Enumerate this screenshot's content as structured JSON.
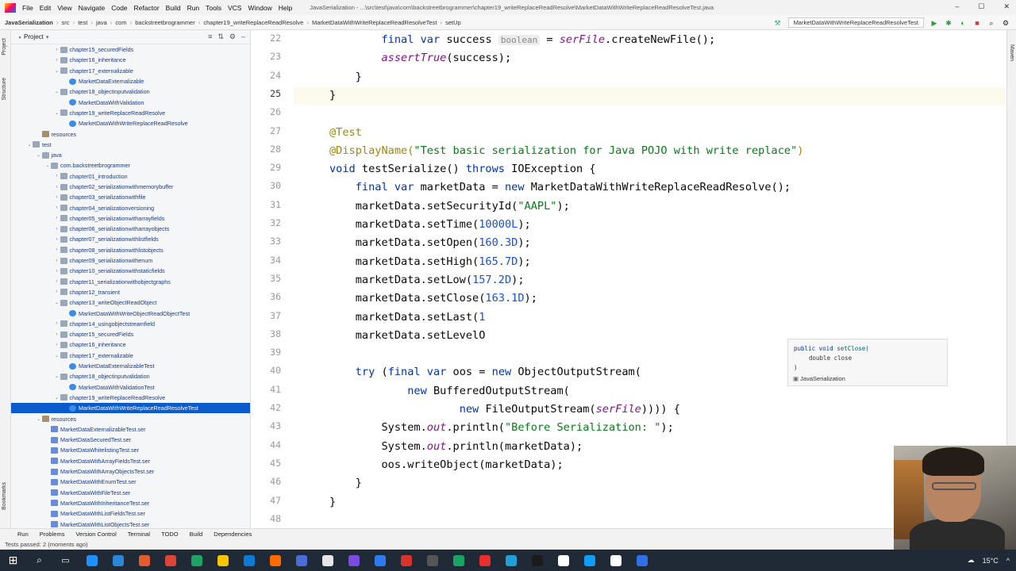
{
  "menubar": {
    "menus": [
      "File",
      "Edit",
      "View",
      "Navigate",
      "Code",
      "Refactor",
      "Build",
      "Run",
      "Tools",
      "VCS",
      "Window",
      "Help"
    ],
    "window_title": "JavaSerialization - ...\\src\\test\\java\\com\\backstreetbrogrammer\\chapter19_writeReplaceReadResolve\\MarketDataWithWriteReplaceReadResolveTest.java"
  },
  "navbar": {
    "crumbs": [
      "JavaSerialization",
      "src",
      "test",
      "java",
      "com",
      "backstreetbrogrammer",
      "chapter19_writeReplaceReadResolve",
      "MarketDataWithWriteReplaceReadResolveTest",
      "setUp"
    ],
    "run_config": "MarketDataWithWriteReplaceReadResolveTest"
  },
  "left_strip": {
    "project": "Project",
    "structure": "Structure",
    "bookmarks": "Bookmarks"
  },
  "right_strip": {
    "maven": "Maven"
  },
  "project_panel": {
    "title": "Project",
    "tree": [
      {
        "label": "chapter15_securedFields",
        "type": "folder",
        "indent": 5,
        "arrow": "›"
      },
      {
        "label": "chapter16_inheritance",
        "type": "folder",
        "indent": 5,
        "arrow": "›"
      },
      {
        "label": "chapter17_externalizable",
        "type": "folder",
        "indent": 5,
        "arrow": "⌄"
      },
      {
        "label": "MarketDataExternalizable",
        "type": "cls",
        "indent": 6,
        "arrow": ""
      },
      {
        "label": "chapter18_objectinputvalidation",
        "type": "folder",
        "indent": 5,
        "arrow": "⌄"
      },
      {
        "label": "MarketDataWithValidation",
        "type": "cls",
        "indent": 6,
        "arrow": ""
      },
      {
        "label": "chapter19_writeReplaceReadResolve",
        "type": "folder",
        "indent": 5,
        "arrow": "⌄"
      },
      {
        "label": "MarketDataWithWriteReplaceReadResolve",
        "type": "cls",
        "indent": 6,
        "arrow": ""
      },
      {
        "label": "resources",
        "type": "res",
        "indent": 3,
        "arrow": ""
      },
      {
        "label": "test",
        "type": "folder",
        "indent": 2,
        "arrow": "⌄"
      },
      {
        "label": "java",
        "type": "folder",
        "indent": 3,
        "arrow": "⌄"
      },
      {
        "label": "com.backstreetbrogrammer",
        "type": "folder",
        "indent": 4,
        "arrow": "⌄"
      },
      {
        "label": "chapter01_introduction",
        "type": "folder",
        "indent": 5,
        "arrow": "›"
      },
      {
        "label": "chapter02_serializationwithmemorybuffer",
        "type": "folder",
        "indent": 5,
        "arrow": "›"
      },
      {
        "label": "chapter03_serializationwithfile",
        "type": "folder",
        "indent": 5,
        "arrow": "›"
      },
      {
        "label": "chapter04_serializationversioning",
        "type": "folder",
        "indent": 5,
        "arrow": "›"
      },
      {
        "label": "chapter05_serializationwitharrayfields",
        "type": "folder",
        "indent": 5,
        "arrow": "›"
      },
      {
        "label": "chapter06_serializationwitharrayobjects",
        "type": "folder",
        "indent": 5,
        "arrow": "›"
      },
      {
        "label": "chapter07_serializationwithlistfields",
        "type": "folder",
        "indent": 5,
        "arrow": "›"
      },
      {
        "label": "chapter08_serializationwithlistobjects",
        "type": "folder",
        "indent": 5,
        "arrow": "›"
      },
      {
        "label": "chapter09_serializationwithenum",
        "type": "folder",
        "indent": 5,
        "arrow": "›"
      },
      {
        "label": "chapter10_serializationwithstaticfields",
        "type": "folder",
        "indent": 5,
        "arrow": "›"
      },
      {
        "label": "chapter11_serializationwithobjectgraphs",
        "type": "folder",
        "indent": 5,
        "arrow": "›"
      },
      {
        "label": "chapter12_transient",
        "type": "folder",
        "indent": 5,
        "arrow": "›"
      },
      {
        "label": "chapter13_writeObjectReadObject",
        "type": "folder",
        "indent": 5,
        "arrow": "⌄"
      },
      {
        "label": "MarketDataWithWriteObjectReadObjectTest",
        "type": "cls",
        "indent": 6,
        "arrow": ""
      },
      {
        "label": "chapter14_usingobjectstreamfield",
        "type": "folder",
        "indent": 5,
        "arrow": "›"
      },
      {
        "label": "chapter15_securedFields",
        "type": "folder",
        "indent": 5,
        "arrow": "›"
      },
      {
        "label": "chapter16_inheritance",
        "type": "folder",
        "indent": 5,
        "arrow": "›"
      },
      {
        "label": "chapter17_externalizable",
        "type": "folder",
        "indent": 5,
        "arrow": "⌄"
      },
      {
        "label": "MarketDataExternalizableTest",
        "type": "cls",
        "indent": 6,
        "arrow": ""
      },
      {
        "label": "chapter18_objectinputvalidation",
        "type": "folder",
        "indent": 5,
        "arrow": "⌄"
      },
      {
        "label": "MarketDataWithValidationTest",
        "type": "cls",
        "indent": 6,
        "arrow": ""
      },
      {
        "label": "chapter19_writeReplaceReadResolve",
        "type": "folder",
        "indent": 5,
        "arrow": "⌄"
      },
      {
        "label": "MarketDataWithWriteReplaceReadResolveTest",
        "type": "cls",
        "indent": 6,
        "arrow": "",
        "selected": true
      },
      {
        "label": "resources",
        "type": "res",
        "indent": 3,
        "arrow": "⌄"
      },
      {
        "label": "MarketDataExternalizableTest.ser",
        "type": "ser",
        "indent": 4,
        "arrow": ""
      },
      {
        "label": "MarketDataSecuredTest.ser",
        "type": "ser",
        "indent": 4,
        "arrow": ""
      },
      {
        "label": "MarketDataWhitelistingTest.ser",
        "type": "ser",
        "indent": 4,
        "arrow": ""
      },
      {
        "label": "MarketDataWithArrayFieldsTest.ser",
        "type": "ser",
        "indent": 4,
        "arrow": ""
      },
      {
        "label": "MarketDataWithArrayObjectsTest.ser",
        "type": "ser",
        "indent": 4,
        "arrow": ""
      },
      {
        "label": "MarketDataWithEnumTest.ser",
        "type": "ser",
        "indent": 4,
        "arrow": ""
      },
      {
        "label": "MarketDataWithFileTest.ser",
        "type": "ser",
        "indent": 4,
        "arrow": ""
      },
      {
        "label": "MarketDataWithInheritanceTest.ser",
        "type": "ser",
        "indent": 4,
        "arrow": ""
      },
      {
        "label": "MarketDataWithListFieldsTest.ser",
        "type": "ser",
        "indent": 4,
        "arrow": ""
      },
      {
        "label": "MarketDataWithListObjectsTest.ser",
        "type": "ser",
        "indent": 4,
        "arrow": ""
      }
    ]
  },
  "editor": {
    "line_numbers": [
      "22",
      "23",
      "24",
      "25",
      "26",
      "27",
      "28",
      "29",
      "30",
      "31",
      "32",
      "33",
      "34",
      "35",
      "36",
      "37",
      "38",
      "39",
      "40",
      "41",
      "42",
      "43",
      "44",
      "45",
      "46",
      "47",
      "48"
    ],
    "inlay_hint": "boolean",
    "lines": [
      [
        {
          "t": "        "
        },
        {
          "t": "final var",
          "c": "kw"
        },
        {
          "t": " success "
        },
        {
          "t": "boolean",
          "c": "hint"
        },
        {
          "t": " = "
        },
        {
          "t": "serFile",
          "c": "fld"
        },
        {
          "t": ".createNewFile();"
        }
      ],
      [
        {
          "t": "        "
        },
        {
          "t": "assertTrue",
          "c": "it"
        },
        {
          "t": "(success);"
        }
      ],
      [
        {
          "t": "    }"
        }
      ],
      [
        {
          "t": "}"
        }
      ],
      [
        {
          "t": ""
        }
      ],
      [
        {
          "t": "@Test",
          "c": "ann"
        }
      ],
      [
        {
          "t": "@DisplayName(",
          "c": "ann"
        },
        {
          "t": "\"Test basic serialization for Java POJO with write replace\"",
          "c": "str"
        },
        {
          "t": ")",
          "c": "ann"
        }
      ],
      [
        {
          "t": "void ",
          "c": "kw"
        },
        {
          "t": "testSerialize() "
        },
        {
          "t": "throws ",
          "c": "kw"
        },
        {
          "t": "IOException {"
        }
      ],
      [
        {
          "t": "    "
        },
        {
          "t": "final var ",
          "c": "kw"
        },
        {
          "t": "marketData = "
        },
        {
          "t": "new ",
          "c": "kw"
        },
        {
          "t": "MarketDataWithWriteReplaceReadResolve();"
        }
      ],
      [
        {
          "t": "    marketData.setSecurityId("
        },
        {
          "t": "\"AAPL\"",
          "c": "str"
        },
        {
          "t": ");"
        }
      ],
      [
        {
          "t": "    marketData.setTime("
        },
        {
          "t": "10000L",
          "c": "num"
        },
        {
          "t": ");"
        }
      ],
      [
        {
          "t": "    marketData.setOpen("
        },
        {
          "t": "160.3D",
          "c": "num"
        },
        {
          "t": ");"
        }
      ],
      [
        {
          "t": "    marketData.setHigh("
        },
        {
          "t": "165.7D",
          "c": "num"
        },
        {
          "t": ");"
        }
      ],
      [
        {
          "t": "    marketData.setLow("
        },
        {
          "t": "157.2D",
          "c": "num"
        },
        {
          "t": ");"
        }
      ],
      [
        {
          "t": "    marketData.setClose("
        },
        {
          "t": "163.1D",
          "c": "num"
        },
        {
          "t": ");"
        }
      ],
      [
        {
          "t": "    marketData.setLast("
        },
        {
          "t": "1",
          "c": "num"
        }
      ],
      [
        {
          "t": "    marketData.setLevelO"
        }
      ],
      [
        {
          "t": ""
        }
      ],
      [
        {
          "t": "    "
        },
        {
          "t": "try ",
          "c": "kw"
        },
        {
          "t": "("
        },
        {
          "t": "final var ",
          "c": "kw"
        },
        {
          "t": "oos = "
        },
        {
          "t": "new ",
          "c": "kw"
        },
        {
          "t": "ObjectOutputStream("
        }
      ],
      [
        {
          "t": "            "
        },
        {
          "t": "new ",
          "c": "kw"
        },
        {
          "t": "BufferedOutputStream("
        }
      ],
      [
        {
          "t": "                    "
        },
        {
          "t": "new ",
          "c": "kw"
        },
        {
          "t": "FileOutputStream("
        },
        {
          "t": "serFile",
          "c": "fld"
        },
        {
          "t": ")))) {"
        }
      ],
      [
        {
          "t": "        System."
        },
        {
          "t": "out",
          "c": "it"
        },
        {
          "t": ".println("
        },
        {
          "t": "\"Before Serialization: \"",
          "c": "str"
        },
        {
          "t": ");"
        }
      ],
      [
        {
          "t": "        System."
        },
        {
          "t": "out",
          "c": "it"
        },
        {
          "t": ".println(marketData);"
        }
      ],
      [
        {
          "t": "        oos.writeObject(marketData);"
        }
      ],
      [
        {
          "t": "    }"
        }
      ],
      [
        {
          "t": "}"
        }
      ],
      [
        {
          "t": ""
        }
      ]
    ]
  },
  "popup": {
    "signature_kw": "public void ",
    "signature_name": "setClose(",
    "param": "double close",
    "close": ")",
    "module": "JavaSerialization"
  },
  "tool_windows": [
    "Run",
    "Problems",
    "Version Control",
    "Terminal",
    "TODO",
    "Build",
    "Dependencies"
  ],
  "status": {
    "text": "Tests passed: 2 (moments ago)"
  },
  "taskbar": {
    "colors": [
      "#1e90ff",
      "#2b88d8",
      "#e45c2e",
      "#db4437",
      "#1ea362",
      "#f7c600",
      "#0d7bd6",
      "#ff6a00",
      "#4a6cd6",
      "#e6e6e6",
      "#7a4be0",
      "#2e7bf0",
      "#d9342b",
      "#555555",
      "#1aa463",
      "#ea2e2e",
      "#1f9ed8",
      "#1b1b1b",
      "#ffffff",
      "#0f9ef5",
      "#ffffff",
      "#2f70e8"
    ],
    "temperature": "15°C"
  }
}
